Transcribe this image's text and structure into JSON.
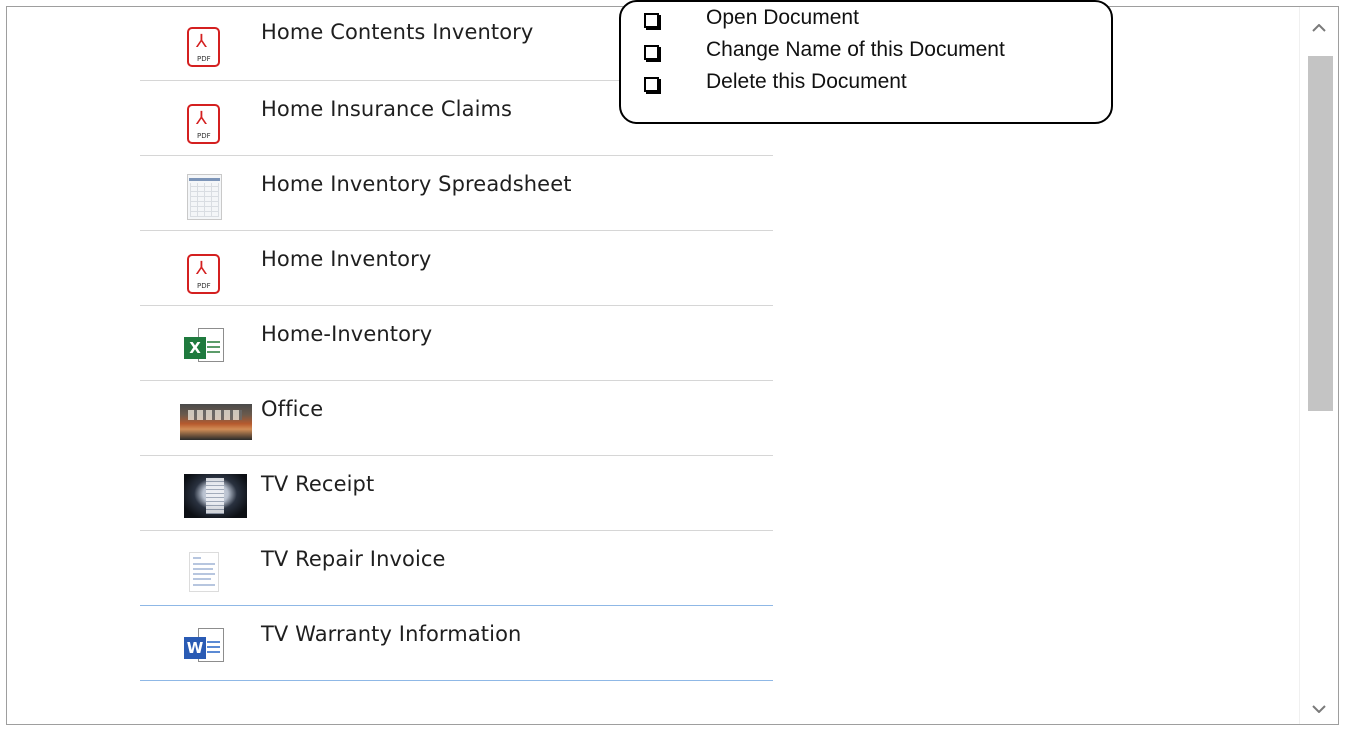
{
  "documents": [
    {
      "name": "Home Contents Inventory",
      "icon": "pdf-icon",
      "pdf_label": "PDF"
    },
    {
      "name": "Home Insurance Claims",
      "icon": "pdf-icon",
      "pdf_label": "PDF"
    },
    {
      "name": "Home Inventory Spreadsheet",
      "icon": "spreadsheet-thumbnail-icon"
    },
    {
      "name": "Home Inventory",
      "icon": "pdf-icon",
      "pdf_label": "PDF"
    },
    {
      "name": "Home-Inventory",
      "icon": "excel-icon",
      "badge": "X"
    },
    {
      "name": "Office",
      "icon": "office-photo-thumbnail"
    },
    {
      "name": "TV Receipt",
      "icon": "receipt-photo-thumbnail"
    },
    {
      "name": "TV Repair Invoice",
      "icon": "invoice-thumbnail-icon"
    },
    {
      "name": "TV Warranty Information",
      "icon": "word-icon",
      "badge": "W"
    }
  ],
  "context_menu": {
    "items": [
      {
        "label": "Open Document"
      },
      {
        "label": "Change Name of this Document"
      },
      {
        "label": "Delete this Document"
      }
    ]
  },
  "colors": {
    "pdf_red": "#d42020",
    "excel_green": "#1f7a3e",
    "word_blue": "#2a5bb4",
    "selected_row_border": "#8fb8e6",
    "scroll_thumb": "#c4c4c4"
  }
}
